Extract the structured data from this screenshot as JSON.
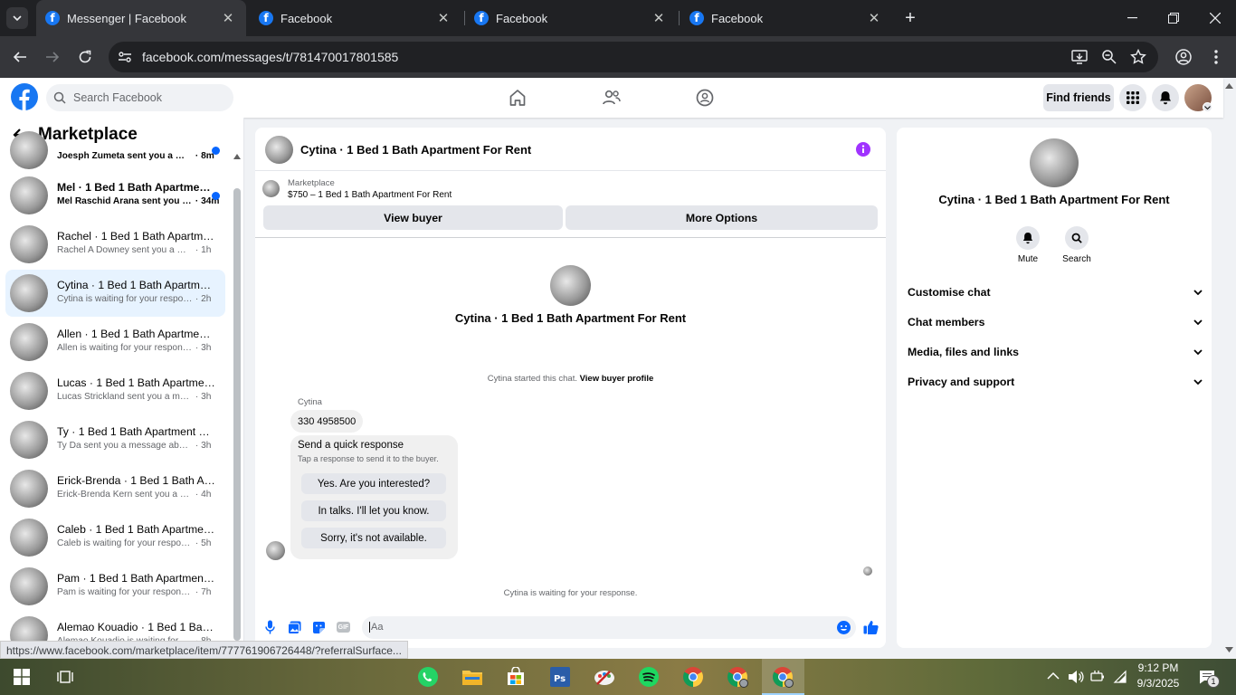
{
  "browser": {
    "tabs": [
      {
        "title": "Messenger | Facebook",
        "active": true
      },
      {
        "title": "Facebook",
        "active": false
      },
      {
        "title": "Facebook",
        "active": false
      },
      {
        "title": "Facebook",
        "active": false
      }
    ],
    "url": "facebook.com/messages/t/781470017801585",
    "status_url": "https://www.facebook.com/marketplace/item/777761906726448/?referralSurface..."
  },
  "fb_header": {
    "search_placeholder": "Search Facebook",
    "find_friends": "Find friends"
  },
  "sidebar": {
    "title": "Marketplace",
    "conversations": [
      {
        "title": "",
        "preview": "Joesph Zumeta sent you a mess...",
        "time": "8m",
        "unread": true,
        "selected": false
      },
      {
        "title": "Mel · 1 Bed 1 Bath Apartment ...",
        "preview": "Mel Raschid Arana sent you a...",
        "time": "34m",
        "unread": true,
        "selected": false
      },
      {
        "title": "Rachel · 1 Bed 1 Bath Apartmen...",
        "preview": "Rachel A Downey sent you a mess...",
        "time": "1h",
        "unread": false,
        "selected": false
      },
      {
        "title": "Cytina · 1 Bed 1 Bath Apartment...",
        "preview": "Cytina is waiting for your response.",
        "time": "2h",
        "unread": false,
        "selected": true
      },
      {
        "title": "Allen · 1 Bed 1 Bath Apartment ...",
        "preview": "Allen is waiting for your response.",
        "time": "3h",
        "unread": false,
        "selected": false
      },
      {
        "title": "Lucas · 1 Bed 1 Bath Apartment ...",
        "preview": "Lucas Strickland sent you a messa...",
        "time": "3h",
        "unread": false,
        "selected": false
      },
      {
        "title": "Ty · 1 Bed 1 Bath Apartment For...",
        "preview": "Ty Da sent you a message about y...",
        "time": "3h",
        "unread": false,
        "selected": false
      },
      {
        "title": "Erick-Brenda · 1 Bed 1 Bath Apar...",
        "preview": "Erick-Brenda Kern sent you a mess...",
        "time": "4h",
        "unread": false,
        "selected": false
      },
      {
        "title": "Caleb · 1 Bed 1 Bath Apartment ...",
        "preview": "Caleb is waiting for your response.",
        "time": "5h",
        "unread": false,
        "selected": false
      },
      {
        "title": "Pam · 1 Bed 1 Bath Apartment F...",
        "preview": "Pam is waiting for your response.",
        "time": "7h",
        "unread": false,
        "selected": false
      },
      {
        "title": "Alemao Kouadio · 1 Bed 1 Bath ...",
        "preview": "Alemao Kouadio is waiting for you...",
        "time": "8h",
        "unread": false,
        "selected": false
      }
    ]
  },
  "chat": {
    "header_title": "Cytina · 1 Bed 1 Bath Apartment For Rent",
    "listing_label": "Marketplace",
    "listing_title": "$750 – 1 Bed 1 Bath Apartment For Rent",
    "view_buyer": "View buyer",
    "more_options": "More Options",
    "center_name": "Cytina · 1 Bed 1 Bath Apartment For Rent",
    "started_text": "Cytina started this chat.",
    "view_buyer_profile": "View buyer profile",
    "sender_name": "Cytina",
    "message": "330 4958500",
    "quick_title": "Send a quick response",
    "quick_sub": "Tap a response to send it to the buyer.",
    "quick_responses": [
      "Yes. Are you interested?",
      "In talks. I'll let you know.",
      "Sorry, it's not available."
    ],
    "waiting_text": "Cytina is waiting for your response.",
    "composer_placeholder": "Aa"
  },
  "details": {
    "name": "Cytina · 1 Bed 1 Bath Apartment For Rent",
    "mute": "Mute",
    "search": "Search",
    "sections": [
      "Customise chat",
      "Chat members",
      "Media, files and links",
      "Privacy and support"
    ]
  },
  "taskbar": {
    "time": "9:12 PM",
    "date": "9/3/2025",
    "notification_count": "1"
  },
  "colors": {
    "facebook_blue": "#1877f2",
    "messenger_accent": "#0866ff",
    "info_purple": "#a033ff"
  }
}
